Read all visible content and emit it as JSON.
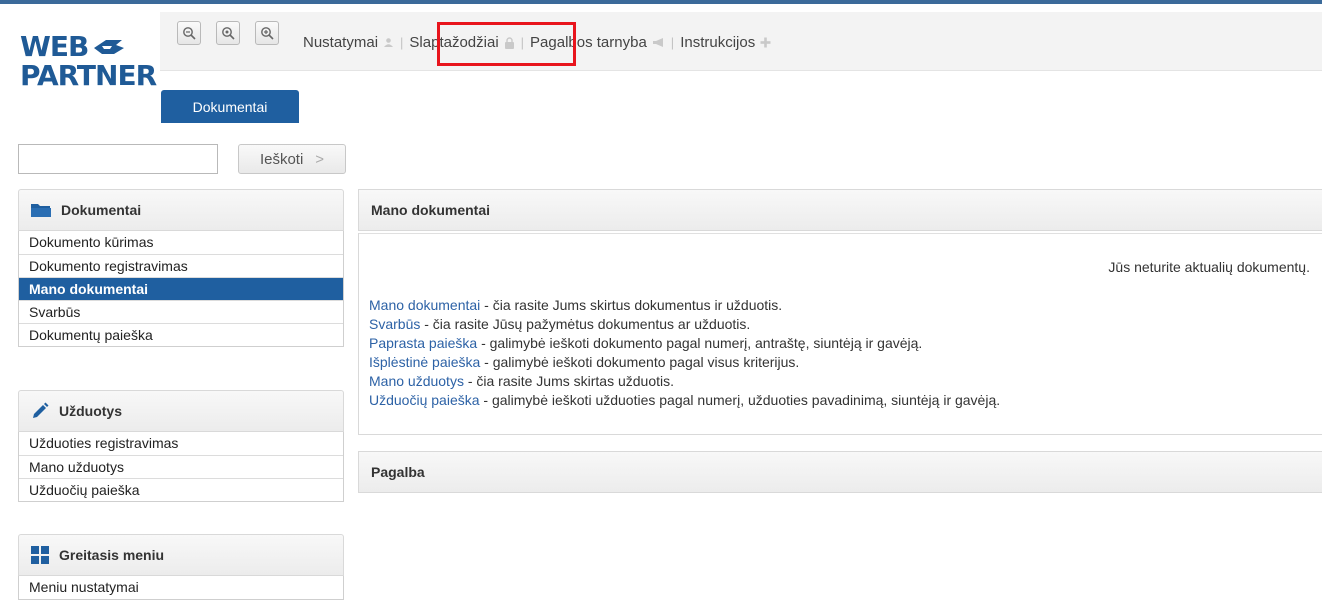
{
  "logo": {
    "line1": "WEB",
    "line2": "PARTNER"
  },
  "toolbar": {
    "zoom_buttons": [
      {
        "icon": "zoom-out-icon"
      },
      {
        "icon": "zoom-reset-icon"
      },
      {
        "icon": "zoom-in-icon"
      }
    ]
  },
  "topnav": {
    "items": [
      {
        "label": "Nustatymai",
        "icon": "user-icon"
      },
      {
        "label": "Slaptažodžiai",
        "icon": "lock-icon"
      },
      {
        "label": "Pagalbos tarnyba",
        "icon": "megaphone-icon"
      },
      {
        "label": "Instrukcijos",
        "icon": "plus-icon"
      }
    ],
    "separator": "|"
  },
  "tabs": {
    "active": "Dokumentai"
  },
  "search": {
    "value": "",
    "button_label": "Ieškoti",
    "button_chevron": ">"
  },
  "sidebar": {
    "dokumentai": {
      "title": "Dokumentai",
      "icon": "folder-icon",
      "items": [
        "Dokumento kūrimas",
        "Dokumento registravimas",
        "Mano dokumentai",
        "Svarbūs",
        "Dokumentų paieška"
      ],
      "active_index": 2
    },
    "uzduotys": {
      "title": "Užduotys",
      "icon": "pencil-icon",
      "items": [
        "Užduoties registravimas",
        "Mano užduotys",
        "Užduočių paieška"
      ]
    },
    "greitasis": {
      "title": "Greitasis meniu",
      "icon": "grid-icon",
      "items": [
        "Meniu nustatymai"
      ]
    }
  },
  "main": {
    "title": "Mano dokumentai",
    "notice": "Jūs neturite aktualių dokumentų.",
    "links": [
      {
        "link": "Mano dokumentai",
        "desc": " - čia rasite Jums skirtus dokumentus ir užduotis."
      },
      {
        "link": "Svarbūs",
        "desc": " - čia rasite Jūsų pažymėtus dokumentus ar užduotis."
      },
      {
        "link": "Paprasta paieška",
        "desc": " - galimybė ieškoti dokumento pagal numerį, antraštę, siuntėją ir gavėją."
      },
      {
        "link": "Išplėstinė paieška",
        "desc": " - galimybė ieškoti dokumento pagal visus kriterijus."
      },
      {
        "link": "Mano užduotys",
        "desc": " - čia rasite Jums skirtas užduotis."
      },
      {
        "link": "Užduočių paieška",
        "desc": " - galimybė ieškoti užduoties pagal numerį, užduoties pavadinimą, siuntėją ir gavėją."
      }
    ],
    "help_title": "Pagalba"
  },
  "colors": {
    "brand": "#1f5a96",
    "active": "#1f5fa0",
    "link": "#2d62a6",
    "highlight": "#e8141c"
  }
}
